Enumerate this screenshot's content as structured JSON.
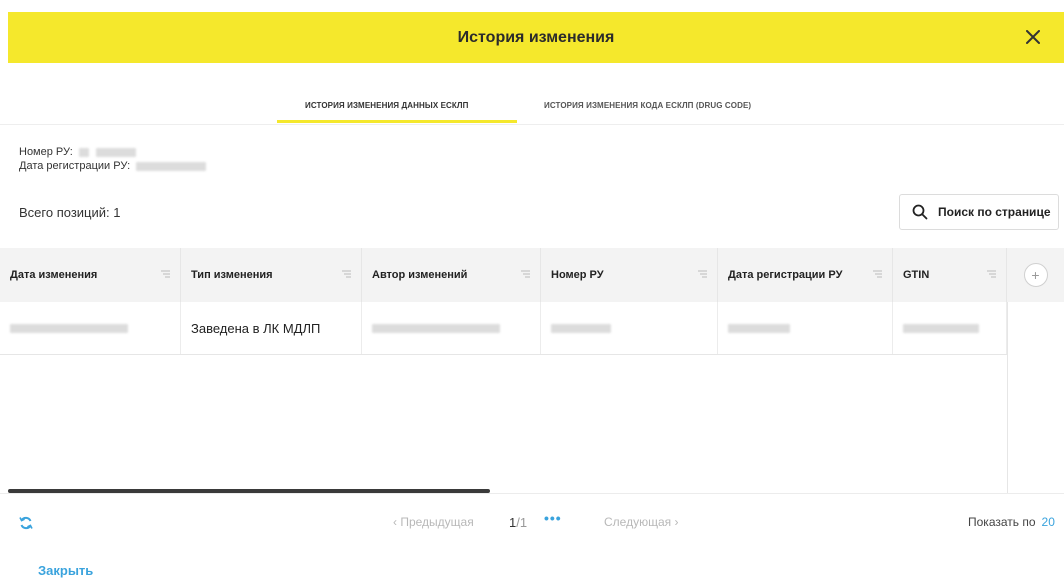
{
  "dialog": {
    "title": "История изменения",
    "close_label": "Закрыть"
  },
  "tabs": [
    {
      "label": "История изменения данных ЕСКЛП",
      "active": true
    },
    {
      "label": "История изменения кода ЕСКЛП (DRUG CODE)",
      "active": false
    }
  ],
  "info": {
    "reg_number_label": "Номер РУ:",
    "reg_number_value_prefix": "",
    "reg_date_label": "Дата регистрации РУ:"
  },
  "summary": {
    "total_label": "Всего позиций:",
    "total_value": "1"
  },
  "search": {
    "label": "Поиск по странице",
    "icon": "search-icon"
  },
  "table": {
    "columns": [
      {
        "label": "Дата изменения"
      },
      {
        "label": "Тип изменения"
      },
      {
        "label": "Автор изменений"
      },
      {
        "label": "Номер РУ"
      },
      {
        "label": "Дата регистрации РУ"
      },
      {
        "label": "GTIN"
      }
    ],
    "rows": [
      {
        "change_type": "Заведена в ЛК МДЛП"
      }
    ]
  },
  "pagination": {
    "prev_label": "‹  Предыдущая",
    "current_page": "1",
    "total_pages": "/1",
    "more": "•••",
    "next_label": "Следующая  ›",
    "page_size_label": "Показать по",
    "page_size_value": "20"
  },
  "colors": {
    "header_bg": "#f5e82c",
    "accent": "#3aa3dd"
  }
}
